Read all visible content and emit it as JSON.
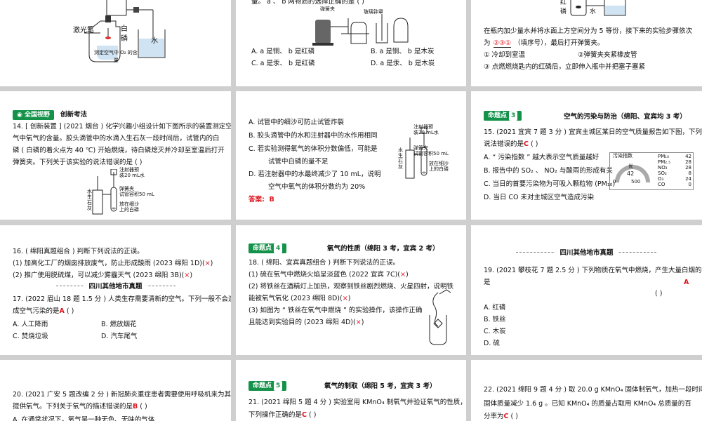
{
  "slide1": {
    "lbl_laser": "激光笔",
    "lbl_bai": "白",
    "lbl_lin": "磷",
    "lbl_water": "水",
    "caption1": "测定空气中 O₂ 的含",
    "caption2": "量"
  },
  "slide2": {
    "top": "量。 a 、 b 两物质的选择正确的是 (          )",
    "lbl_stopper": "弹簧夹",
    "lbl_glass": "玻璃钟罩",
    "opt_a": "A. a 是铜、 b 是红磷",
    "opt_b": "B. a 是铜、 b 是木炭",
    "opt_c": "C. a 是汞、 b 是红磷",
    "opt_d": "D. a 是汞、 b 是木炭"
  },
  "slide3": {
    "lbl_red": "红",
    "lbl_lin": "磷",
    "lbl_water": "水",
    "l1": "在瓶内加少量水并将水面上方空间分为 5 等份，接下来的实验步骤依次",
    "l2_pre": "为",
    "l2_ans": "②③①",
    "l2_post": "（填序号），最后打开弹簧夹。",
    "s1": "① 冷却到室温",
    "s2": "②弹簧夹夹紧橡皮管",
    "s3": "③ 点燃燃烧匙内的红磷后，立即伸入瓶中并把塞子塞紧"
  },
  "slide4": {
    "tag": "全国视野",
    "tag_after": "创新考法",
    "q1": "14. [ 创新装置 ] (2021 烟台 ) 化学兴趣小组设计如下图所示的装置测定空",
    "q2": "气中氧气的含量。胶头滴管中的水滴入生石灰一段时间后，试管内的白",
    "q3": "磷 ( 白磷的着火点为 40 ℃) 开始燃烧，待白磷熄灭并冷却至室温后打开",
    "q4": "弹簧夹。下列关于该实验的说法错误的是 (          )",
    "d1": "注射器预",
    "d2": "装20 mL水",
    "d3": "弹簧夹",
    "d4": "试管容积50 mL",
    "d5": "放在细沙",
    "d6": "上的白磷",
    "d_side": [
      "水",
      "生",
      "石",
      "灰"
    ]
  },
  "slide5": {
    "a": "A.  试管中的细沙可防止试管炸裂",
    "b": "B.  胶头滴管中的水和注射器中的水作用相同",
    "c1": "C.  若实验测得氧气的体积分数偏低，可能是",
    "c2": "试管中白磷的量不足",
    "dd1": "D.  若注射器中的水最终减少了 10 mL，说明",
    "dd2": "空气中氧气的体积分数约为 20%",
    "ans_label": "答案:",
    "ans": "B",
    "d1": "注射器预",
    "d2": "装20 mL水",
    "d3": "弹簧夹",
    "d4": "试管容积50 mL",
    "d5": "放在细沙",
    "d6": "上的白磷",
    "d_side": [
      "水",
      "生",
      "石",
      "灰"
    ]
  },
  "slide6": {
    "tag": "命题点",
    "tag_num": "3",
    "title": "空气的污染与防治（绵阳、宜宾均 3 考）",
    "q1": "15. (2021 宜宾 7 题 3 分 ) 宜宾主城区某日的空气质量报告如下图，下列",
    "q2_pre": "说法错误的是",
    "q2_ans": "C",
    "q2_post": " (          )",
    "a": "A. “ 污染指数 ” 越大表示空气质量越好",
    "b": "B. 报告中的 SO₂ 、 NO₂ 与酸雨的形成有关",
    "c": "C. 当日的首要污染物为可吸入颗粒物 (PM₁₀)",
    "d": "D. 当日 CO 未对主城区空气造成污染",
    "aqi_title": "污染指数",
    "aqi_grade": "优",
    "aqi_value": "42",
    "aqi_min": "0",
    "aqi_max": "500",
    "aqi_rows": [
      {
        "k": "PM₁₀",
        "v": "42"
      },
      {
        "k": "PM₂.₅",
        "v": "28"
      },
      {
        "k": "NO₂",
        "v": "28"
      },
      {
        "k": "SO₂",
        "v": "8"
      },
      {
        "k": "O₃",
        "v": "24"
      },
      {
        "k": "CO",
        "v": "0"
      }
    ]
  },
  "slide7": {
    "title": "16. ( 绵阳真题组合 ) 判断下列说法的正误。",
    "i1": "(1) 加高化工厂的烟囱排放废气，防止形成酸雨 (2023 绵阳 1D)(",
    "i1_mark": "×",
    "i1_end": ")",
    "i2": "(2) 推广使用脱硫煤，可以减少雾霾天气 (2023 绵阳 3B)(",
    "i2_mark": "×",
    "i2_end": ")",
    "sec": "四川其他地市真题",
    "q1": "17. (2022 眉山 18 题 1.5 分 ) 人类生存需要清新的空气。下列一般不会造",
    "q2_pre": "成空气污染的是",
    "q2_ans": "A",
    "q2_post": " (          )",
    "a": "A.  人工降雨",
    "b": "B.  燃放烟花",
    "c": "C.  焚烧垃圾",
    "d": "D.  汽车尾气"
  },
  "slide8": {
    "tag": "命题点",
    "tag_num": "4",
    "title": "氧气的性质（绵阳 3 考，宜宾 2 考）",
    "q": "18. ( 绵阳、宜宾真题组合 ) 判断下列说法的正误。",
    "i1": "(1) 硫在氧气中燃烧火焰呈淡蓝色 (2022 宜宾 7C)(",
    "i1_mark": "×",
    "i1_end": ")",
    "i2a": "(2) 将铁丝在酒精灯上加热，观察到铁丝剧烈燃烧、火星四射，说明铁",
    "i2b": "能被氧气氧化 (2023 绵阳 8D)(",
    "i2_mark": "×",
    "i2_end": ")",
    "i3a": "(3) 如图为 “ 铁丝在氧气中燃烧 ” 的实验操作，该操作正确",
    "i3b": "且能达到实验目的 (2023 绵阳 4D)(",
    "i3_mark": "×",
    "i3_end": ")"
  },
  "slide9": {
    "sec": "四川其他地市真题",
    "q1": "19. (2021 攀枝花 7 题 2.5 分 ) 下列物质在氧气中燃烧，产生大量白烟的",
    "q2": "是",
    "ans": "A",
    "paren": "(          )",
    "a": "A.  红磷",
    "b": "B.  铁丝",
    "c": "C.  木炭",
    "d": "D.  硫"
  },
  "slide10": {
    "q1": "20. (2021 广安 5 题改编 2 分 ) 新冠肺炎重症患者需要使用呼吸机来为其",
    "q2_pre": "提供氧气。下列关于氧气的描述错误的是",
    "q2_ans": "B",
    "q2_post": " (          )",
    "a": "A.  在通常状况下，氧气是一种无色、无味的气体"
  },
  "slide11": {
    "tag": "命题点",
    "tag_num": "5",
    "title": "氧气的制取（绵阳 5 考，宜宾 3 考）",
    "q1": "21. (2021 绵阳 5 题 4 分 ) 实验室用 KMnO₄ 制氧气并验证氧气的性质，",
    "q2_pre": "下列操作正确的是",
    "q2_ans": "C",
    "q2_post": " (          )"
  },
  "slide12": {
    "q1": "22. (2021 绵阳 9 题 4 分 ) 取 20.0 g KMnO₄ 固体制氧气，加热一段时间后，",
    "q2": "固体质量减少 1.6 g 。已知 KMnO₄ 的质量占取用 KMnO₄ 总质量的百",
    "q3_pre": "分率为",
    "q3_ans": "C",
    "q3_post": " (          )"
  }
}
